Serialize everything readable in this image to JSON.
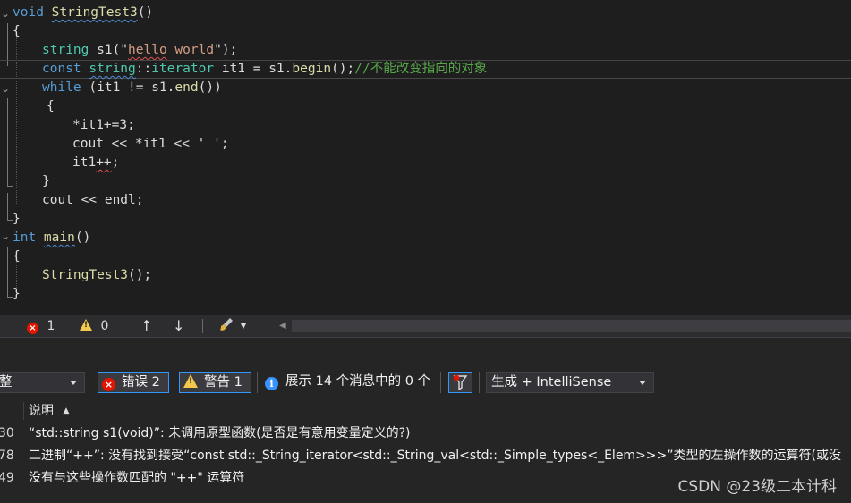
{
  "code_lines": [
    [
      "",
      ""
    ],
    [
      {
        "t": "void ",
        "c": "kw"
      },
      {
        "t": "StringTest3",
        "c": "fn squig"
      },
      {
        "t": "()",
        "c": "id"
      }
    ],
    [
      {
        "t": "{",
        "c": "id"
      }
    ],
    [],
    [
      {
        "t": "string ",
        "c": "ty"
      },
      {
        "t": "s1",
        "c": "id"
      },
      {
        "t": "(\"",
        "c": "id"
      },
      {
        "t": "hello",
        "c": "str squig-red"
      },
      {
        "t": " world",
        "c": "str"
      },
      {
        "t": "\");",
        "c": "id"
      }
    ],
    [
      {
        "t": "const ",
        "c": "kw"
      },
      {
        "t": "string",
        "c": "ty squig"
      },
      {
        "t": "::",
        "c": "id"
      },
      {
        "t": "iterator",
        "c": "ty"
      },
      {
        "t": " it1 = s1.",
        "c": "id"
      },
      {
        "t": "begin",
        "c": "fn"
      },
      {
        "t": "();",
        "c": "id"
      },
      {
        "t": "//不能改变指向的对象",
        "c": "cm"
      }
    ],
    [
      {
        "t": "while",
        "c": "kw"
      },
      {
        "t": " (it1 != s1.",
        "c": "id"
      },
      {
        "t": "end",
        "c": "fn"
      },
      {
        "t": "())",
        "c": "id"
      }
    ],
    [
      {
        "t": "{",
        "c": "id"
      }
    ],
    [
      {
        "t": "*it1+=3;",
        "c": "id"
      }
    ],
    [
      {
        "t": "cout << *it1 << ' ';",
        "c": "id"
      }
    ],
    [
      {
        "t": "it1",
        "c": "id"
      },
      {
        "t": "++",
        "c": "id squig-red"
      },
      {
        "t": ";",
        "c": "id"
      }
    ],
    [
      {
        "t": "}",
        "c": "id"
      }
    ],
    [
      {
        "t": "cout << endl;",
        "c": "id"
      }
    ],
    [
      {
        "t": "}",
        "c": "id"
      }
    ],
    [
      {
        "t": "int ",
        "c": "kw"
      },
      {
        "t": "main",
        "c": "fn squig"
      },
      {
        "t": "()",
        "c": "id"
      }
    ],
    [
      {
        "t": "{",
        "c": "id"
      }
    ],
    [
      {
        "t": "StringTest3",
        "c": "fn"
      },
      {
        "t": "();",
        "c": "id"
      }
    ],
    [
      {
        "t": "}",
        "c": "id"
      }
    ]
  ],
  "status": {
    "error_count": "1",
    "warning_count": "0",
    "up_arrow": "↑",
    "down_arrow": "↓",
    "brush_icon": "brush-icon"
  },
  "toolbar": {
    "scope_value": "整",
    "errors_label": "错误 2",
    "warnings_label": "警告 1",
    "messages_label": "展示 14 个消息中的 0 个",
    "build_filter": "生成 + IntelliSense"
  },
  "table": {
    "header_description": "说明",
    "rows": [
      {
        "code": "30",
        "description": "“std::string s1(void)”: 未调用原型函数(是否是有意用变量定义的?)"
      },
      {
        "code": "78",
        "description": "二进制“++”: 没有找到接受“const std::_String_iterator<std::_String_val<std::_Simple_types<_Elem>>>”类型的左操作数的运算符(或没"
      },
      {
        "code": "49",
        "description": "没有与这些操作数匹配的 \"++\" 运算符"
      }
    ]
  },
  "watermark": "CSDN @23级二本计科",
  "colors": {
    "error": "#e51400",
    "warning": "#f2c94c",
    "accent": "#3399ff",
    "keyword": "#569cd6",
    "type": "#4ec9b0",
    "function": "#dcdcaa",
    "comment": "#57a64a"
  }
}
